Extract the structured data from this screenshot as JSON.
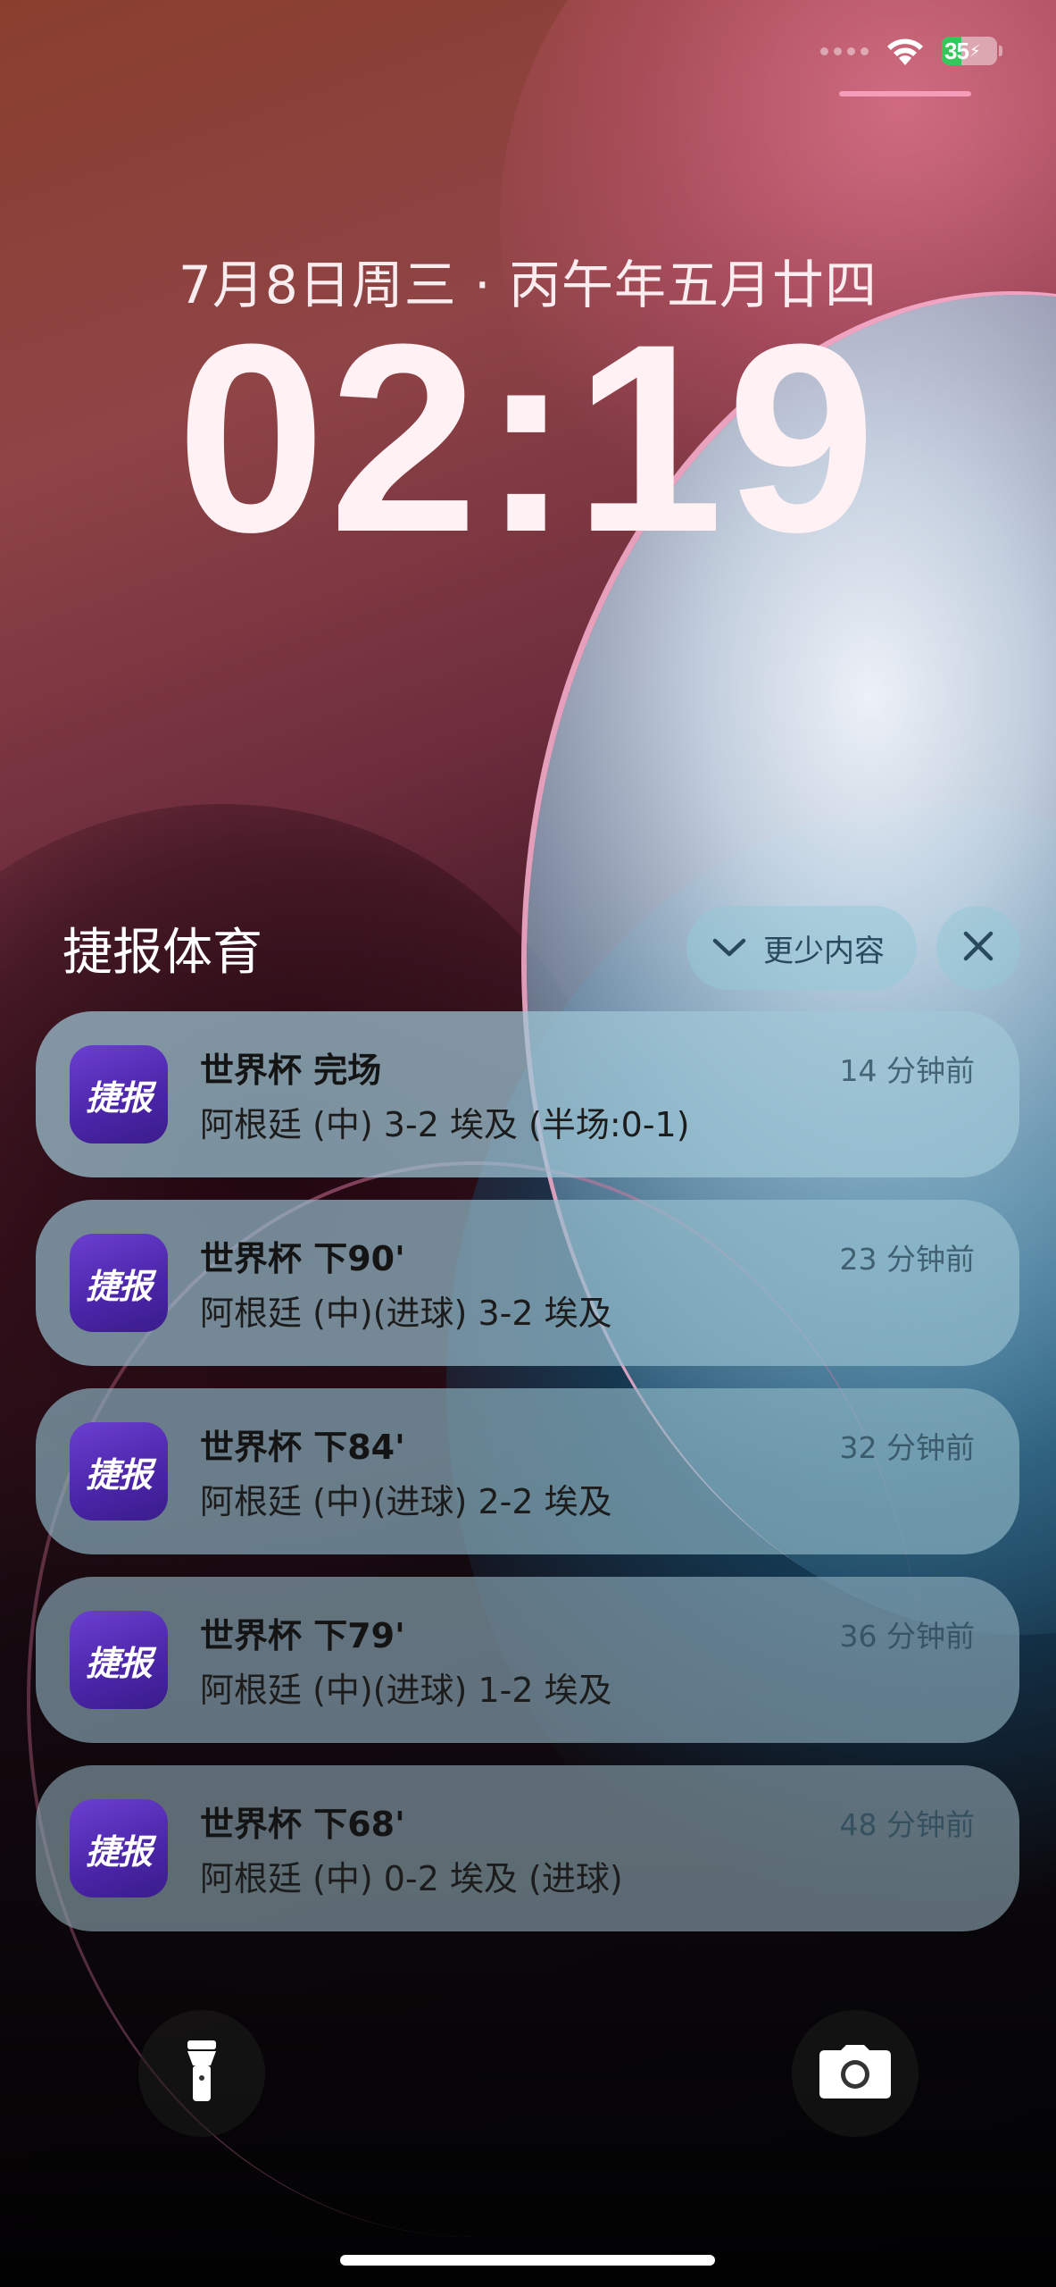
{
  "status_bar": {
    "battery_level": "35",
    "battery_charging": true,
    "icons": [
      "signal-dots-icon",
      "wifi-icon",
      "battery-icon",
      "charging-bolt-icon"
    ]
  },
  "lock_screen": {
    "date": "7月8日周三 · 丙午年五月廿四",
    "time": "02:19"
  },
  "notification_group": {
    "app_name": "捷报体育",
    "show_less_label": "更少内容",
    "icons": [
      "chevron-down-icon",
      "close-icon"
    ]
  },
  "notifications": [
    {
      "app_icon_text": "捷报",
      "title": "世界杯 完场",
      "body": "阿根廷 (中) 3-2 埃及 (半场:0-1)",
      "time": "14 分钟前"
    },
    {
      "app_icon_text": "捷报",
      "title": "世界杯 下90'",
      "body": "阿根廷 (中)(进球) 3-2 埃及",
      "time": "23 分钟前"
    },
    {
      "app_icon_text": "捷报",
      "title": "世界杯 下84'",
      "body": "阿根廷 (中)(进球) 2-2 埃及",
      "time": "32 分钟前"
    },
    {
      "app_icon_text": "捷报",
      "title": "世界杯 下79'",
      "body": "阿根廷 (中)(进球) 1-2 埃及",
      "time": "36 分钟前"
    },
    {
      "app_icon_text": "捷报",
      "title": "世界杯 下68'",
      "body": "阿根廷 (中) 0-2 埃及 (进球)",
      "time": "48 分钟前"
    }
  ],
  "bottom_controls": {
    "icons": [
      "flashlight-icon",
      "camera-icon"
    ]
  },
  "colors": {
    "app_icon": "#5a30bd",
    "battery_fill": "#34c759"
  }
}
